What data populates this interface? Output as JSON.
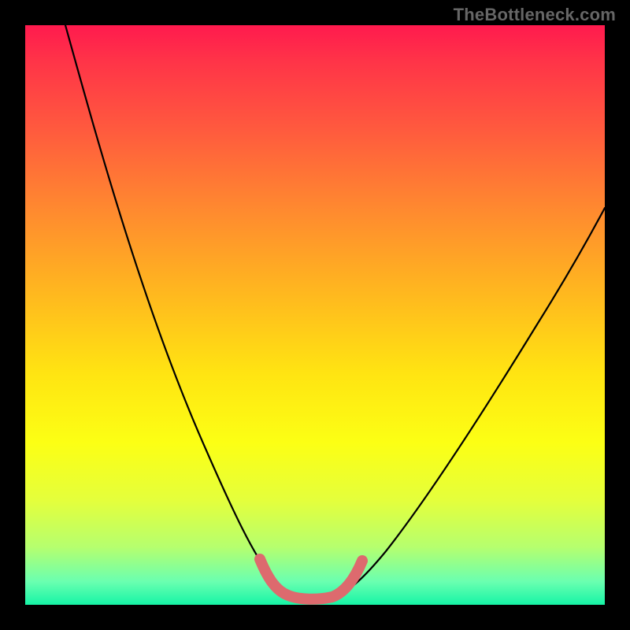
{
  "watermark": {
    "text": "TheBottleneck.com"
  },
  "chart_data": {
    "type": "line",
    "title": "",
    "xlabel": "",
    "ylabel": "",
    "xlim": [
      0,
      100
    ],
    "ylim": [
      0,
      100
    ],
    "background_gradient": [
      "#ff1a4e",
      "#ffe412",
      "#16f4a6"
    ],
    "series": [
      {
        "name": "left-branch",
        "x": [
          7,
          10,
          14,
          18,
          22,
          26,
          30,
          34,
          37,
          39,
          41
        ],
        "y": [
          100,
          86,
          72,
          58,
          46,
          34,
          24,
          15,
          9,
          6,
          4
        ]
      },
      {
        "name": "right-branch",
        "x": [
          51,
          54,
          58,
          63,
          68,
          74,
          80,
          87,
          94,
          100
        ],
        "y": [
          4,
          6,
          10,
          16,
          24,
          33,
          42,
          52,
          62,
          71
        ]
      },
      {
        "name": "trough-highlight",
        "x": [
          38,
          40,
          42,
          44,
          46,
          48,
          50,
          52
        ],
        "y": [
          8,
          4,
          2.5,
          2,
          2,
          2.5,
          4,
          8
        ]
      }
    ],
    "annotations": []
  },
  "colors": {
    "curve": "#000000",
    "highlight": "#dd6a6e"
  }
}
